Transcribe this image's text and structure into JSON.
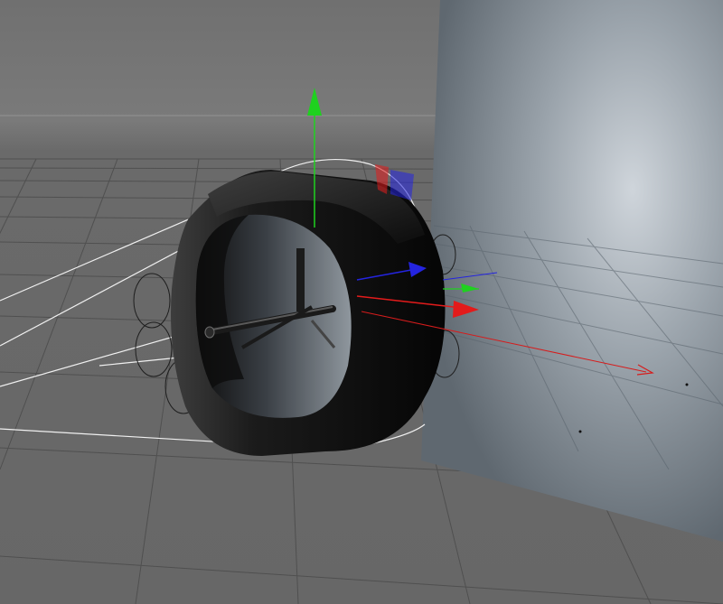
{
  "viewport": {
    "view": "perspective",
    "background_color": "#6d6d6d",
    "grid_color": "#3c3c3c",
    "panel_color": "#7b8691",
    "panel_highlight_color": "#c5ccd3",
    "object_color": "#1a1a1a",
    "wireframe_color": "#f2f2f2"
  },
  "axis_gizmo": {
    "x_color": "#e31b1b",
    "y_color": "#1fd11f",
    "z_color": "#2424e0"
  },
  "icons": {
    "move_gizmo": "move-gizmo-icon",
    "rotation_handles": "rotation-handles-icon"
  }
}
